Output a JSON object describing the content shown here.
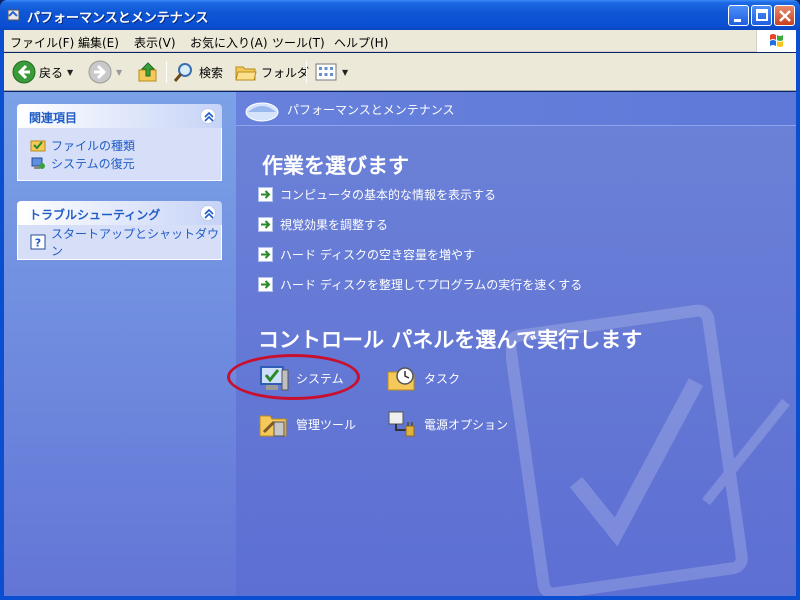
{
  "window": {
    "title": "パフォーマンスとメンテナンス"
  },
  "menu": [
    "ファイル(F)",
    "編集(E)",
    "表示(V)",
    "お気に入り(A)",
    "ツール(T)",
    "ヘルプ(H)"
  ],
  "toolbar": {
    "back_label": "戻る",
    "search_label": "検索",
    "folders_label": "フォルダ"
  },
  "sidebar": {
    "related": {
      "title": "関連項目",
      "items": [
        "ファイルの種類",
        "システムの復元"
      ]
    },
    "troubleshoot": {
      "title": "トラブルシューティング",
      "items": [
        "スタートアップとシャットダウン"
      ]
    }
  },
  "main": {
    "header": "パフォーマンスとメンテナンス",
    "tasks_title": "作業を選びます",
    "tasks": [
      "コンピュータの基本的な情報を表示する",
      "視覚効果を調整する",
      "ハード ディスクの空き容量を増やす",
      "ハード ディスクを整理してプログラムの実行を速くする"
    ],
    "icons_title": "コントロール パネルを選んで実行します",
    "icons": [
      "システム",
      "タスク",
      "管理ツール",
      "電源オプション"
    ]
  },
  "colors": {
    "link": "#215dc6",
    "pane_bg": "#6375d6",
    "highlight": "#c8102e"
  }
}
